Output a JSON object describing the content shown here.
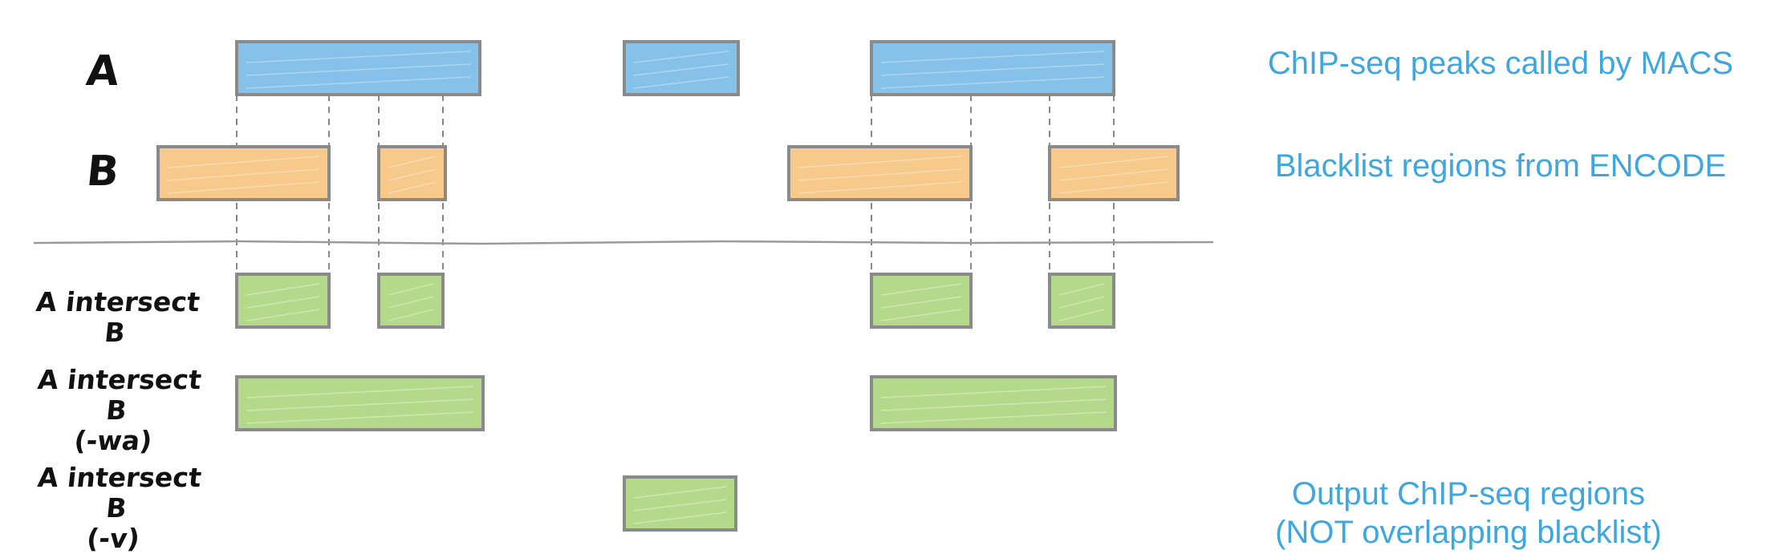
{
  "rows": [
    {
      "id": "A",
      "label": "A",
      "style": "peak",
      "note": "ChIP-seq peaks called by MACS",
      "intervals": [
        [
          295,
          598
        ],
        [
          778,
          920
        ],
        [
          1086,
          1388
        ]
      ]
    },
    {
      "id": "B",
      "label": "B",
      "style": "blacklist",
      "note": "Blacklist regions from ENCODE",
      "intervals": [
        [
          197,
          410
        ],
        [
          472,
          555
        ],
        [
          983,
          1210
        ],
        [
          1308,
          1468
        ]
      ]
    },
    {
      "id": "intersect",
      "label": "A intersect B",
      "sub": "",
      "style": "result",
      "intervals": [
        [
          295,
          410
        ],
        [
          472,
          552
        ],
        [
          1086,
          1210
        ],
        [
          1308,
          1388
        ]
      ]
    },
    {
      "id": "intersect-wa",
      "label": "A intersect B",
      "sub": "(-wa)",
      "style": "result",
      "intervals": [
        [
          295,
          602
        ],
        [
          1086,
          1390
        ]
      ]
    },
    {
      "id": "intersect-v",
      "label": "A intersect B",
      "sub": "(-v)",
      "style": "result",
      "intervals": [
        [
          778,
          917
        ]
      ]
    }
  ],
  "output_note": {
    "line1": "Output ChIP-seq regions",
    "line2": "(NOT overlapping blacklist)"
  },
  "colors": {
    "peak": "#85C1E9",
    "blacklist": "#F7C98A",
    "result": "#B5D98A",
    "outline": "#8A8A8A",
    "note": "#3FA7DC"
  },
  "guide_positions": [
    295,
    410,
    472,
    552,
    1086,
    1210,
    1308,
    1388
  ]
}
